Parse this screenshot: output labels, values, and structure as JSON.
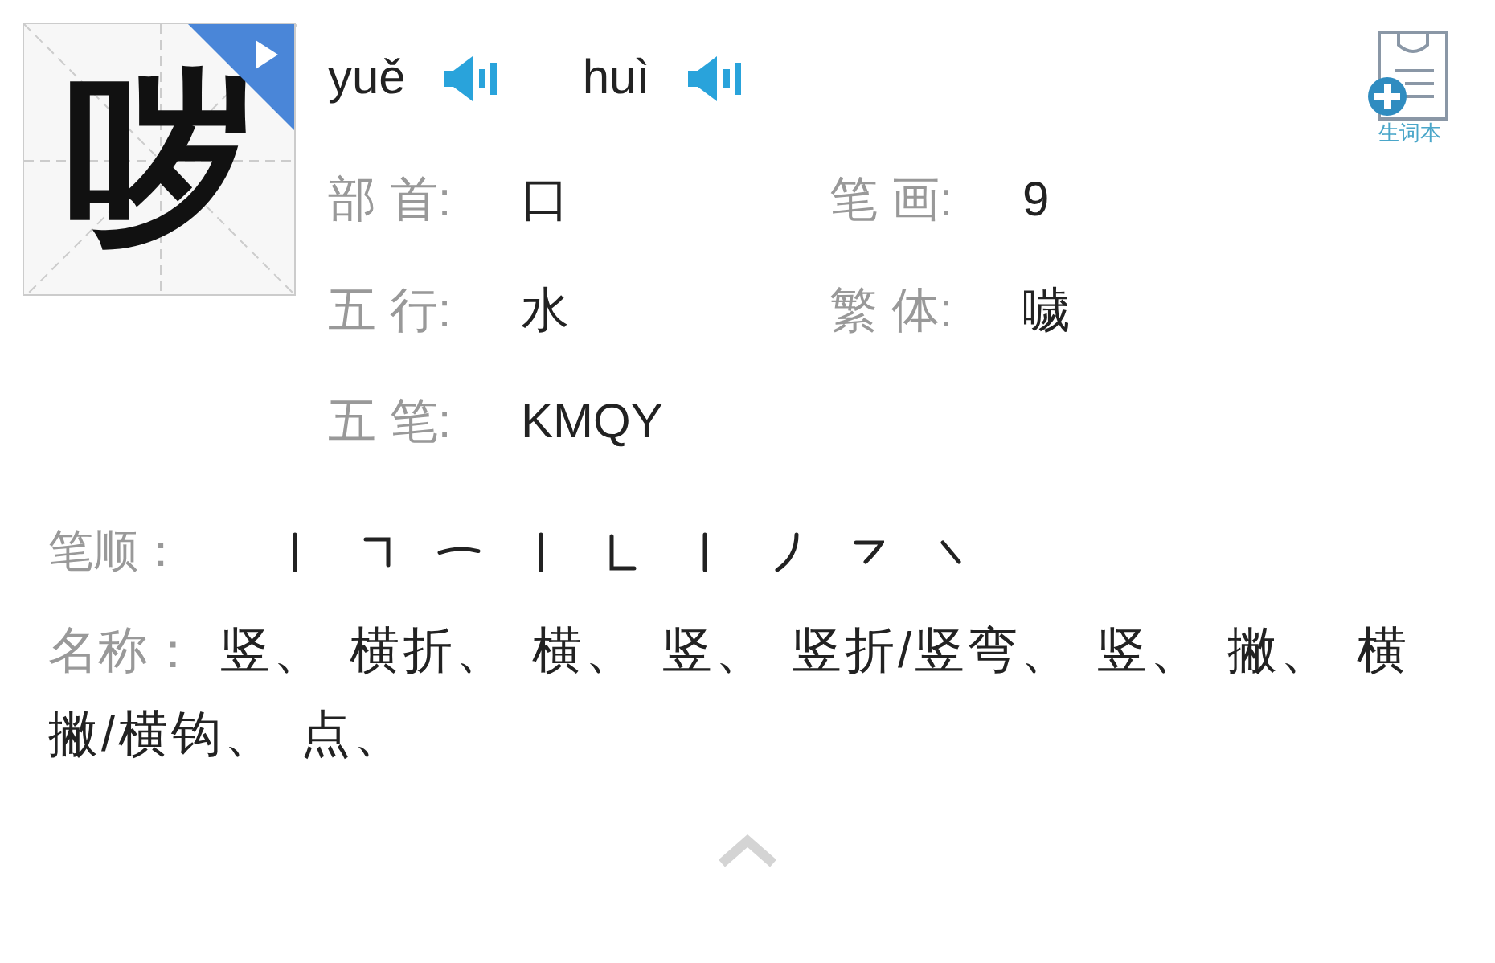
{
  "character": {
    "glyph": "哕",
    "play": true
  },
  "readings": [
    {
      "pinyin": "yuě"
    },
    {
      "pinyin": "huì"
    }
  ],
  "wordbook": {
    "label": "生词本"
  },
  "fields": [
    [
      {
        "label": "部 首:",
        "value": "口"
      },
      {
        "label": "笔 画:",
        "value": "9"
      }
    ],
    [
      {
        "label": "五 行:",
        "value": "水"
      },
      {
        "label": "繁 体:",
        "value": "噦"
      }
    ],
    [
      {
        "label": "五 笔:",
        "value": "KMQY"
      }
    ]
  ],
  "stroke_order": {
    "label": "笔顺：",
    "strokes": [
      {
        "kind": "shu"
      },
      {
        "kind": "hengzhe"
      },
      {
        "kind": "heng"
      },
      {
        "kind": "shu"
      },
      {
        "kind": "shuzhe"
      },
      {
        "kind": "shu"
      },
      {
        "kind": "pie"
      },
      {
        "kind": "hengpie"
      },
      {
        "kind": "dian"
      }
    ]
  },
  "names": {
    "label": "名称：",
    "lines": [
      "竖、 横折、 横、 竖、 竖折/竖弯、 竖、 撇、 横",
      "撇/横钩、 点、"
    ]
  }
}
